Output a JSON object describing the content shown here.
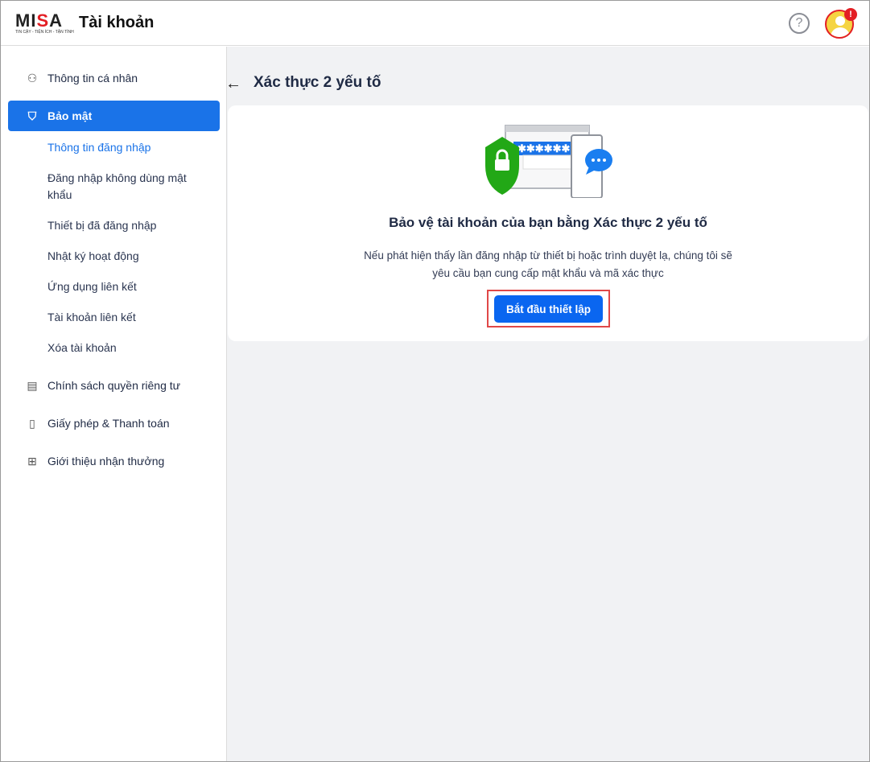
{
  "header": {
    "logo_text": "MISA",
    "logo_tagline": "TIN CẬY - TIỆN ÍCH - TẬN TÌNH",
    "app_title": "Tài khoản",
    "help_icon": "?",
    "notification_badge": "!"
  },
  "sidebar": {
    "items": [
      {
        "label": "Thông tin cá nhân",
        "icon": "person-icon"
      },
      {
        "label": "Bảo mật",
        "icon": "shield-icon"
      },
      {
        "label": "Chính sách quyền riêng tư",
        "icon": "document-icon"
      },
      {
        "label": "Giấy phép & Thanh toán",
        "icon": "receipt-icon"
      },
      {
        "label": "Giới thiệu nhận thưởng",
        "icon": "gift-icon"
      }
    ],
    "security_sub": [
      "Thông tin đăng nhập",
      "Đăng nhập không dùng mật khẩu",
      "Thiết bị đã đăng nhập",
      "Nhật ký hoạt động",
      "Ứng dụng liên kết",
      "Tài khoản liên kết",
      "Xóa tài khoản"
    ]
  },
  "main": {
    "title": "Xác thực 2 yếu tố",
    "card": {
      "heading": "Bảo vệ tài khoản của bạn bằng Xác thực 2 yếu tố",
      "description": "Nếu phát hiện thấy lần đăng nhập từ thiết bị hoặc trình duyệt lạ, chúng tôi sẽ yêu cầu bạn cung cấp mật khẩu và mã xác thực",
      "button": "Bắt đầu thiết lập",
      "password_mask": "******"
    }
  },
  "colors": {
    "accent": "#1a73e8",
    "button": "#0a66f0",
    "shield": "#22a816",
    "highlight": "#e04848"
  }
}
